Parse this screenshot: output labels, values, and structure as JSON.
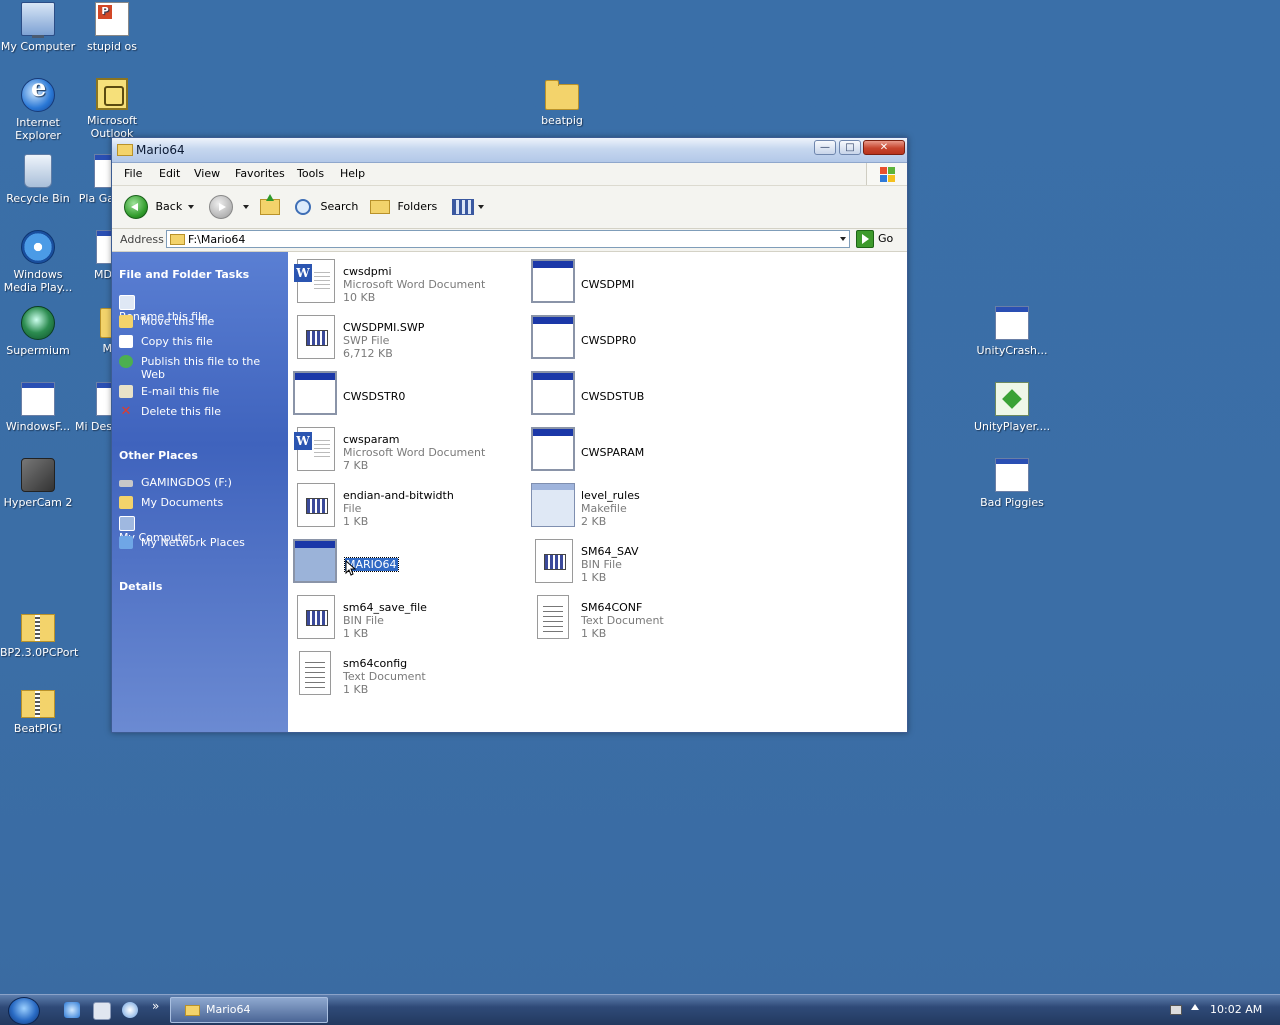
{
  "desktop": {
    "icons": [
      {
        "label": "My Computer"
      },
      {
        "label": "stupid os"
      },
      {
        "label": "Internet Explorer"
      },
      {
        "label": "Microsoft Outlook"
      },
      {
        "label": "beatpig"
      },
      {
        "label": "Recycle Bin"
      },
      {
        "label": "Pla Ga"
      },
      {
        "label": "Windows Media Play..."
      },
      {
        "label": "MD"
      },
      {
        "label": "Supermium"
      },
      {
        "label": "M"
      },
      {
        "label": "WindowsF..."
      },
      {
        "label": "Mi Des"
      },
      {
        "label": "HyperCam 2"
      },
      {
        "label": "BP2.3.0PCPort"
      },
      {
        "label": "BeatPIG!"
      },
      {
        "label": "UnityCrash..."
      },
      {
        "label": "UnityPlayer...."
      },
      {
        "label": "Bad Piggies"
      }
    ]
  },
  "window": {
    "title": "Mario64",
    "menu": [
      "File",
      "Edit",
      "View",
      "Favorites",
      "Tools",
      "Help"
    ],
    "toolbar": {
      "back": "Back",
      "search": "Search",
      "folders": "Folders"
    },
    "address": {
      "label": "Address",
      "value": "F:\\Mario64",
      "go": "Go"
    },
    "tasks": {
      "heading": "File and Folder Tasks",
      "items": [
        "Rename this file",
        "Move this file",
        "Copy this file",
        "Publish this file to the Web",
        "E-mail this file",
        "Delete this file"
      ]
    },
    "other_places": {
      "heading": "Other Places",
      "items": [
        "GAMINGDOS (F:)",
        "My Documents",
        "My Computer",
        "My Network Places"
      ]
    },
    "details": {
      "heading": "Details"
    },
    "files": [
      {
        "name": "cwsdpmi",
        "type": "Microsoft Word Document",
        "size": "10 KB",
        "icon": "word-doc-icon"
      },
      {
        "name": "CWSDPMI",
        "type": "",
        "size": "",
        "icon": "application-icon"
      },
      {
        "name": "CWSDPMI.SWP",
        "type": "SWP File",
        "size": "6,712 KB",
        "icon": "binary-file-icon"
      },
      {
        "name": "CWSDPR0",
        "type": "",
        "size": "",
        "icon": "application-icon"
      },
      {
        "name": "CWSDSTR0",
        "type": "",
        "size": "",
        "icon": "application-icon"
      },
      {
        "name": "CWSDSTUB",
        "type": "",
        "size": "",
        "icon": "application-icon"
      },
      {
        "name": "cwsparam",
        "type": "Microsoft Word Document",
        "size": "7 KB",
        "icon": "word-doc-icon"
      },
      {
        "name": "CWSPARAM",
        "type": "",
        "size": "",
        "icon": "application-icon"
      },
      {
        "name": "endian-and-bitwidth",
        "type": "File",
        "size": "1 KB",
        "icon": "binary-file-icon"
      },
      {
        "name": "level_rules",
        "type": "Makefile",
        "size": "2 KB",
        "icon": "makefile-icon"
      },
      {
        "name": "MARIO64",
        "type": "",
        "size": "",
        "icon": "application-icon",
        "selected": true
      },
      {
        "name": "SM64_SAV",
        "type": "BIN File",
        "size": "1 KB",
        "icon": "binary-file-icon"
      },
      {
        "name": "sm64_save_file",
        "type": "BIN File",
        "size": "1 KB",
        "icon": "binary-file-icon"
      },
      {
        "name": "SM64CONF",
        "type": "Text Document",
        "size": "1 KB",
        "icon": "text-doc-icon"
      },
      {
        "name": "sm64config",
        "type": "Text Document",
        "size": "1 KB",
        "icon": "text-doc-icon"
      }
    ]
  },
  "taskbar": {
    "task_label": "Mario64",
    "show_more": "»",
    "clock": "10:02 AM"
  },
  "colors": {
    "desktop": "#3a6ea5",
    "task_pane": "#4a6fc6",
    "selection": "#316ac5"
  }
}
